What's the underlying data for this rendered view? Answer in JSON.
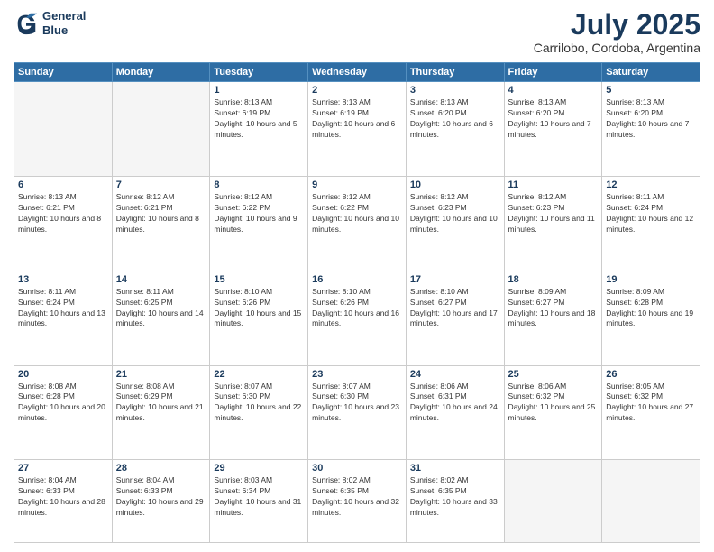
{
  "header": {
    "logo_line1": "General",
    "logo_line2": "Blue",
    "title": "July 2025",
    "subtitle": "Carrilobo, Cordoba, Argentina"
  },
  "weekdays": [
    "Sunday",
    "Monday",
    "Tuesday",
    "Wednesday",
    "Thursday",
    "Friday",
    "Saturday"
  ],
  "weeks": [
    [
      {
        "day": "",
        "empty": true
      },
      {
        "day": "",
        "empty": true
      },
      {
        "day": "1",
        "sunrise": "Sunrise: 8:13 AM",
        "sunset": "Sunset: 6:19 PM",
        "daylight": "Daylight: 10 hours and 5 minutes."
      },
      {
        "day": "2",
        "sunrise": "Sunrise: 8:13 AM",
        "sunset": "Sunset: 6:19 PM",
        "daylight": "Daylight: 10 hours and 6 minutes."
      },
      {
        "day": "3",
        "sunrise": "Sunrise: 8:13 AM",
        "sunset": "Sunset: 6:20 PM",
        "daylight": "Daylight: 10 hours and 6 minutes."
      },
      {
        "day": "4",
        "sunrise": "Sunrise: 8:13 AM",
        "sunset": "Sunset: 6:20 PM",
        "daylight": "Daylight: 10 hours and 7 minutes."
      },
      {
        "day": "5",
        "sunrise": "Sunrise: 8:13 AM",
        "sunset": "Sunset: 6:20 PM",
        "daylight": "Daylight: 10 hours and 7 minutes."
      }
    ],
    [
      {
        "day": "6",
        "sunrise": "Sunrise: 8:13 AM",
        "sunset": "Sunset: 6:21 PM",
        "daylight": "Daylight: 10 hours and 8 minutes."
      },
      {
        "day": "7",
        "sunrise": "Sunrise: 8:12 AM",
        "sunset": "Sunset: 6:21 PM",
        "daylight": "Daylight: 10 hours and 8 minutes."
      },
      {
        "day": "8",
        "sunrise": "Sunrise: 8:12 AM",
        "sunset": "Sunset: 6:22 PM",
        "daylight": "Daylight: 10 hours and 9 minutes."
      },
      {
        "day": "9",
        "sunrise": "Sunrise: 8:12 AM",
        "sunset": "Sunset: 6:22 PM",
        "daylight": "Daylight: 10 hours and 10 minutes."
      },
      {
        "day": "10",
        "sunrise": "Sunrise: 8:12 AM",
        "sunset": "Sunset: 6:23 PM",
        "daylight": "Daylight: 10 hours and 10 minutes."
      },
      {
        "day": "11",
        "sunrise": "Sunrise: 8:12 AM",
        "sunset": "Sunset: 6:23 PM",
        "daylight": "Daylight: 10 hours and 11 minutes."
      },
      {
        "day": "12",
        "sunrise": "Sunrise: 8:11 AM",
        "sunset": "Sunset: 6:24 PM",
        "daylight": "Daylight: 10 hours and 12 minutes."
      }
    ],
    [
      {
        "day": "13",
        "sunrise": "Sunrise: 8:11 AM",
        "sunset": "Sunset: 6:24 PM",
        "daylight": "Daylight: 10 hours and 13 minutes."
      },
      {
        "day": "14",
        "sunrise": "Sunrise: 8:11 AM",
        "sunset": "Sunset: 6:25 PM",
        "daylight": "Daylight: 10 hours and 14 minutes."
      },
      {
        "day": "15",
        "sunrise": "Sunrise: 8:10 AM",
        "sunset": "Sunset: 6:26 PM",
        "daylight": "Daylight: 10 hours and 15 minutes."
      },
      {
        "day": "16",
        "sunrise": "Sunrise: 8:10 AM",
        "sunset": "Sunset: 6:26 PM",
        "daylight": "Daylight: 10 hours and 16 minutes."
      },
      {
        "day": "17",
        "sunrise": "Sunrise: 8:10 AM",
        "sunset": "Sunset: 6:27 PM",
        "daylight": "Daylight: 10 hours and 17 minutes."
      },
      {
        "day": "18",
        "sunrise": "Sunrise: 8:09 AM",
        "sunset": "Sunset: 6:27 PM",
        "daylight": "Daylight: 10 hours and 18 minutes."
      },
      {
        "day": "19",
        "sunrise": "Sunrise: 8:09 AM",
        "sunset": "Sunset: 6:28 PM",
        "daylight": "Daylight: 10 hours and 19 minutes."
      }
    ],
    [
      {
        "day": "20",
        "sunrise": "Sunrise: 8:08 AM",
        "sunset": "Sunset: 6:28 PM",
        "daylight": "Daylight: 10 hours and 20 minutes."
      },
      {
        "day": "21",
        "sunrise": "Sunrise: 8:08 AM",
        "sunset": "Sunset: 6:29 PM",
        "daylight": "Daylight: 10 hours and 21 minutes."
      },
      {
        "day": "22",
        "sunrise": "Sunrise: 8:07 AM",
        "sunset": "Sunset: 6:30 PM",
        "daylight": "Daylight: 10 hours and 22 minutes."
      },
      {
        "day": "23",
        "sunrise": "Sunrise: 8:07 AM",
        "sunset": "Sunset: 6:30 PM",
        "daylight": "Daylight: 10 hours and 23 minutes."
      },
      {
        "day": "24",
        "sunrise": "Sunrise: 8:06 AM",
        "sunset": "Sunset: 6:31 PM",
        "daylight": "Daylight: 10 hours and 24 minutes."
      },
      {
        "day": "25",
        "sunrise": "Sunrise: 8:06 AM",
        "sunset": "Sunset: 6:32 PM",
        "daylight": "Daylight: 10 hours and 25 minutes."
      },
      {
        "day": "26",
        "sunrise": "Sunrise: 8:05 AM",
        "sunset": "Sunset: 6:32 PM",
        "daylight": "Daylight: 10 hours and 27 minutes."
      }
    ],
    [
      {
        "day": "27",
        "sunrise": "Sunrise: 8:04 AM",
        "sunset": "Sunset: 6:33 PM",
        "daylight": "Daylight: 10 hours and 28 minutes."
      },
      {
        "day": "28",
        "sunrise": "Sunrise: 8:04 AM",
        "sunset": "Sunset: 6:33 PM",
        "daylight": "Daylight: 10 hours and 29 minutes."
      },
      {
        "day": "29",
        "sunrise": "Sunrise: 8:03 AM",
        "sunset": "Sunset: 6:34 PM",
        "daylight": "Daylight: 10 hours and 31 minutes."
      },
      {
        "day": "30",
        "sunrise": "Sunrise: 8:02 AM",
        "sunset": "Sunset: 6:35 PM",
        "daylight": "Daylight: 10 hours and 32 minutes."
      },
      {
        "day": "31",
        "sunrise": "Sunrise: 8:02 AM",
        "sunset": "Sunset: 6:35 PM",
        "daylight": "Daylight: 10 hours and 33 minutes."
      },
      {
        "day": "",
        "empty": true
      },
      {
        "day": "",
        "empty": true
      }
    ]
  ]
}
